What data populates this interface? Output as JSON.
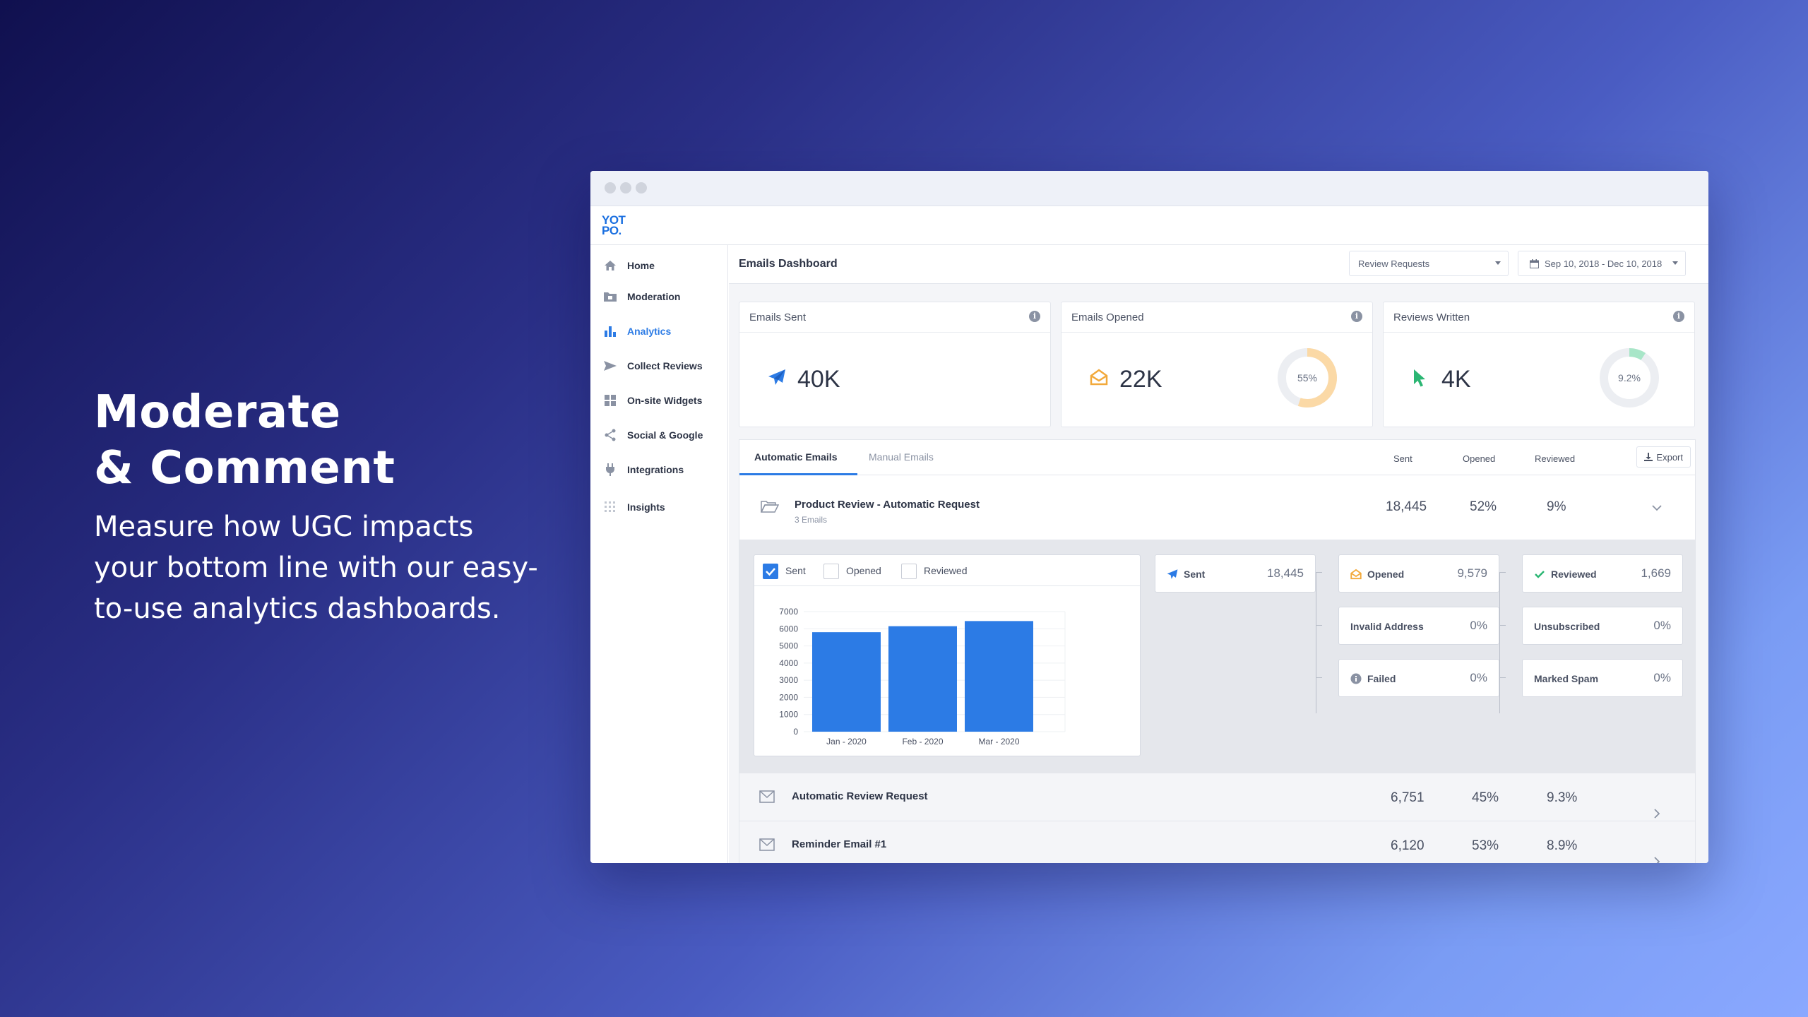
{
  "hero": {
    "title_line1": "Moderate",
    "title_line2": "& Comment",
    "subtitle": "Measure how UGC impacts your bottom line with our easy-to-use analytics dashboards."
  },
  "app": {
    "logo_line1": "YOT",
    "logo_line2": "PO."
  },
  "sidebar": {
    "items": [
      {
        "label": "Home",
        "icon": "home-icon"
      },
      {
        "label": "Moderation",
        "icon": "folder-icon"
      },
      {
        "label": "Analytics",
        "icon": "bar-chart-icon",
        "active": true
      },
      {
        "label": "Collect Reviews",
        "icon": "send-icon"
      },
      {
        "label": "On-site Widgets",
        "icon": "widgets-icon"
      },
      {
        "label": "Social & Google",
        "icon": "share-icon"
      },
      {
        "label": "Integrations",
        "icon": "plug-icon"
      },
      {
        "label": "Insights",
        "icon": "grid-icon"
      }
    ]
  },
  "header": {
    "title": "Emails Dashboard",
    "type_select": "Review Requests",
    "date_range": "Sep 10, 2018 - Dec 10, 2018"
  },
  "cards": [
    {
      "title": "Emails Sent",
      "value": "40K",
      "icon": "paper-plane-icon"
    },
    {
      "title": "Emails Opened",
      "value": "22K",
      "icon": "open-envelope-icon",
      "donut_label": "55%",
      "donut_fraction": 0.55,
      "donut_color": "#fbd9a6"
    },
    {
      "title": "Reviews Written",
      "value": "4K",
      "icon": "cursor-icon",
      "donut_label": "9.2%",
      "donut_fraction": 0.092,
      "donut_color": "#a8e6c8"
    }
  ],
  "tabs": {
    "automatic": "Automatic Emails",
    "manual": "Manual Emails"
  },
  "columns": {
    "sent": "Sent",
    "opened": "Opened",
    "reviewed": "Reviewed",
    "export": "Export"
  },
  "group": {
    "title": "Product Review - Automatic Request",
    "sub": "3 Emails",
    "sent": "18,445",
    "opened": "52%",
    "reviewed": "9%"
  },
  "legend": {
    "sent": "Sent",
    "opened": "Opened",
    "reviewed": "Reviewed"
  },
  "chart_data": {
    "type": "bar",
    "categories": [
      "Jan - 2020",
      "Feb - 2020",
      "Mar - 2020"
    ],
    "values": [
      5800,
      6150,
      6450
    ],
    "yticks": [
      0,
      1000,
      2000,
      3000,
      4000,
      5000,
      6000,
      7000
    ],
    "ylim": [
      0,
      7000
    ],
    "color": "#2c7be5"
  },
  "stats": {
    "sent": {
      "label": "Sent",
      "value": "18,445"
    },
    "opened": {
      "label": "Opened",
      "value": "9,579"
    },
    "reviewed": {
      "label": "Reviewed",
      "value": "1,669"
    },
    "invalid": {
      "label": "Invalid Address",
      "value": "0%"
    },
    "unsubscribed": {
      "label": "Unsubscribed",
      "value": "0%"
    },
    "failed": {
      "label": "Failed",
      "value": "0%"
    },
    "spam": {
      "label": "Marked Spam",
      "value": "0%"
    }
  },
  "emails": [
    {
      "title": "Automatic Review Request",
      "sent": "6,751",
      "opened": "45%",
      "reviewed": "9.3%"
    },
    {
      "title": "Reminder Email #1",
      "sent": "6,120",
      "opened": "53%",
      "reviewed": "8.9%"
    }
  ]
}
